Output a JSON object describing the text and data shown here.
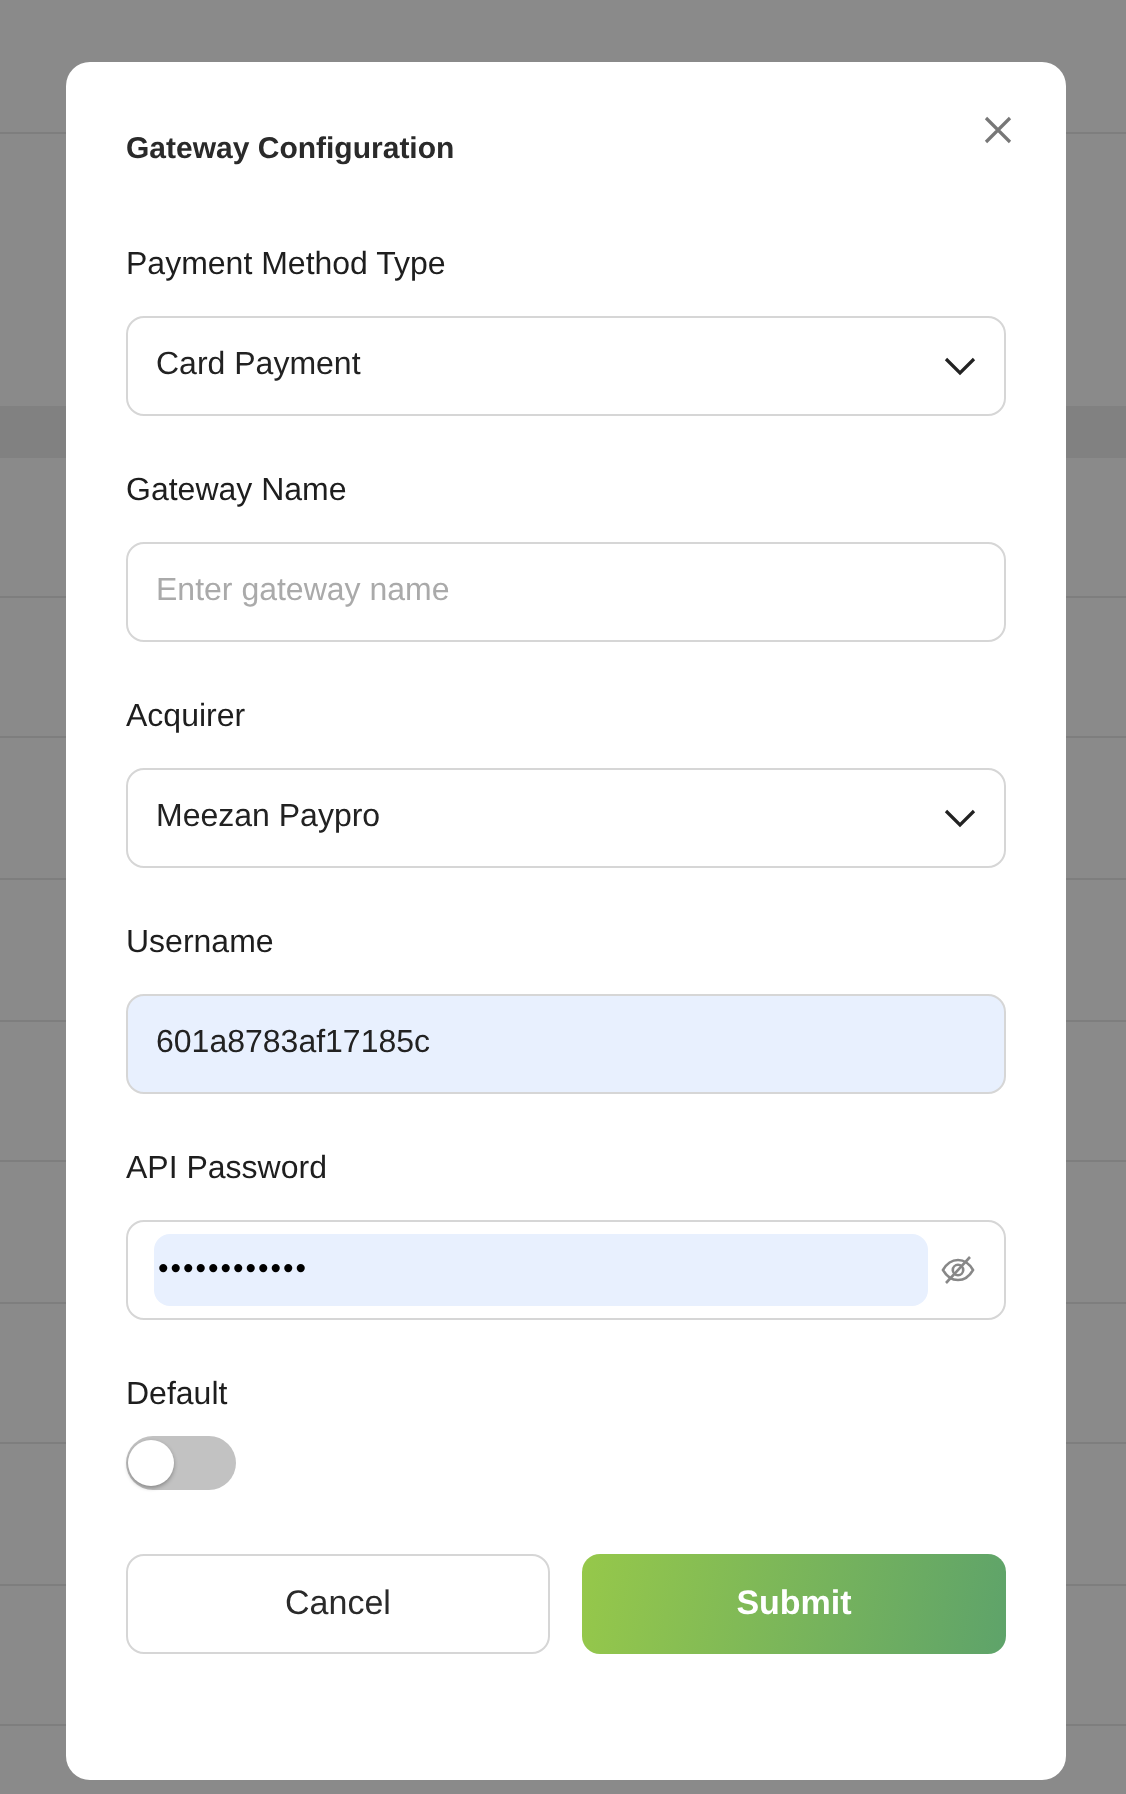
{
  "dialog": {
    "title": "Gateway Configuration",
    "fields": [
      {
        "kind": "select",
        "label": "Payment Method Type",
        "value": "Card Payment"
      },
      {
        "kind": "text",
        "label": "Gateway Name",
        "placeholder": "Enter gateway name"
      },
      {
        "kind": "select",
        "label": "Acquirer",
        "value": "Meezan Paypro"
      },
      {
        "kind": "text",
        "label": "Username",
        "value": "601a8783af17185c",
        "autofilled": true
      },
      {
        "kind": "password",
        "label": "API Password",
        "value": "••••••••••••",
        "autofilled": true
      }
    ],
    "default": {
      "label": "Default",
      "on": false
    },
    "buttons": [
      {
        "kind": "secondary",
        "label": "Cancel"
      },
      {
        "kind": "primary",
        "label": "Submit"
      }
    ]
  }
}
